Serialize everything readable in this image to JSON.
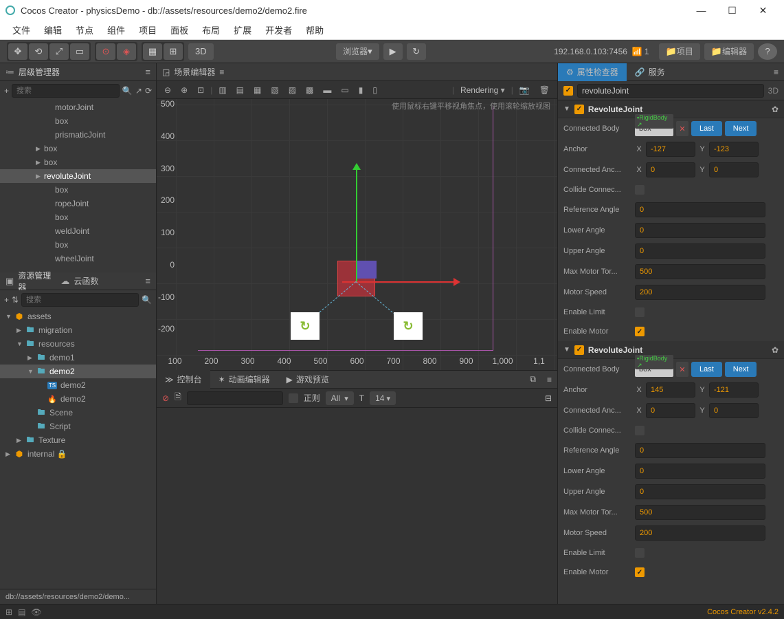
{
  "window": {
    "title": "Cocos Creator - physicsDemo - db://assets/resources/demo2/demo2.fire"
  },
  "menu": [
    "文件",
    "编辑",
    "节点",
    "组件",
    "项目",
    "面板",
    "布局",
    "扩展",
    "开发者",
    "帮助"
  ],
  "toolbar": {
    "ip": "192.168.0.103:7456",
    "count": "1",
    "browser": "浏览器",
    "mode3d": "3D",
    "project": "项目",
    "editor": "编辑器"
  },
  "panels": {
    "hierarchy": "层级管理器",
    "assets": "资源管理器",
    "cloud": "云函数",
    "scene": "场景编辑器",
    "console": "控制台",
    "animation": "动画编辑器",
    "preview": "游戏预览",
    "inspector": "属性检查器",
    "service": "服务",
    "search_ph": "搜索",
    "rendering": "Rendering",
    "regex": "正则",
    "all": "All",
    "fontsize": "14"
  },
  "hierarchy": [
    {
      "label": "motorJoint",
      "indent": 3
    },
    {
      "label": "box",
      "indent": 3
    },
    {
      "label": "prismaticJoint",
      "indent": 3
    },
    {
      "label": "box",
      "indent": 2,
      "arrow": true
    },
    {
      "label": "box",
      "indent": 2,
      "arrow": true
    },
    {
      "label": "revoluteJoint",
      "indent": 2,
      "arrow": true,
      "sel": true
    },
    {
      "label": "box",
      "indent": 3
    },
    {
      "label": "ropeJoint",
      "indent": 3
    },
    {
      "label": "box",
      "indent": 3
    },
    {
      "label": "weldJoint",
      "indent": 3
    },
    {
      "label": "box",
      "indent": 3
    },
    {
      "label": "wheelJoint",
      "indent": 3
    }
  ],
  "assets": [
    {
      "label": "assets",
      "indent": 0,
      "arrow": "▼",
      "icon": "pkg"
    },
    {
      "label": "migration",
      "indent": 1,
      "arrow": "▶",
      "icon": "folder"
    },
    {
      "label": "resources",
      "indent": 1,
      "arrow": "▼",
      "icon": "folder"
    },
    {
      "label": "demo1",
      "indent": 2,
      "arrow": "▶",
      "icon": "folder"
    },
    {
      "label": "demo2",
      "indent": 2,
      "arrow": "▼",
      "icon": "folder",
      "sel": true
    },
    {
      "label": "demo2",
      "indent": 3,
      "icon": "ts"
    },
    {
      "label": "demo2",
      "indent": 3,
      "icon": "fire"
    },
    {
      "label": "Scene",
      "indent": 2,
      "icon": "folder"
    },
    {
      "label": "Script",
      "indent": 2,
      "icon": "folder"
    },
    {
      "label": "Texture",
      "indent": 1,
      "arrow": "▶",
      "icon": "folder"
    },
    {
      "label": "internal",
      "indent": 0,
      "arrow": "▶",
      "icon": "pkg",
      "lock": true
    }
  ],
  "scene": {
    "hint": "使用鼠标右键平移视角焦点，使用滚轮缩放视图",
    "xticks": [
      "100",
      "200",
      "300",
      "400",
      "500",
      "600",
      "700",
      "800",
      "900",
      "1,000",
      "1,1"
    ],
    "yticks": [
      "500",
      "400",
      "300",
      "200",
      "100",
      "0",
      "-100",
      "-200"
    ]
  },
  "inspector": {
    "nodeName": "revoluteJoint",
    "badge3d": "3D",
    "components": [
      {
        "title": "RevoluteJoint",
        "body": {
          "ref": "box",
          "reftype": "RigidBody"
        },
        "last": "Last",
        "next": "Next",
        "anchor": {
          "x": "-127",
          "y": "-123"
        },
        "connAnchor": {
          "x": "0",
          "y": "0"
        },
        "collide": false,
        "refAngle": "0",
        "lower": "0",
        "upper": "0",
        "maxTorque": "500",
        "motorSpeed": "200",
        "enableLimit": false,
        "enableMotor": true
      },
      {
        "title": "RevoluteJoint",
        "body": {
          "ref": "box",
          "reftype": "RigidBody"
        },
        "last": "Last",
        "next": "Next",
        "anchor": {
          "x": "145",
          "y": "-121"
        },
        "connAnchor": {
          "x": "0",
          "y": "0"
        },
        "collide": false,
        "refAngle": "0",
        "lower": "0",
        "upper": "0",
        "maxTorque": "500",
        "motorSpeed": "200",
        "enableLimit": false,
        "enableMotor": true
      }
    ],
    "labels": {
      "connectedBody": "Connected Body",
      "anchor": "Anchor",
      "connectedAnc": "Connected Anc...",
      "collide": "Collide Connec...",
      "refAngle": "Reference Angle",
      "lower": "Lower Angle",
      "upper": "Upper Angle",
      "maxTorque": "Max Motor Tor...",
      "motorSpeed": "Motor Speed",
      "enableLimit": "Enable Limit",
      "enableMotor": "Enable Motor"
    }
  },
  "pathbar": "db://assets/resources/demo2/demo...",
  "version": "Cocos Creator v2.4.2"
}
